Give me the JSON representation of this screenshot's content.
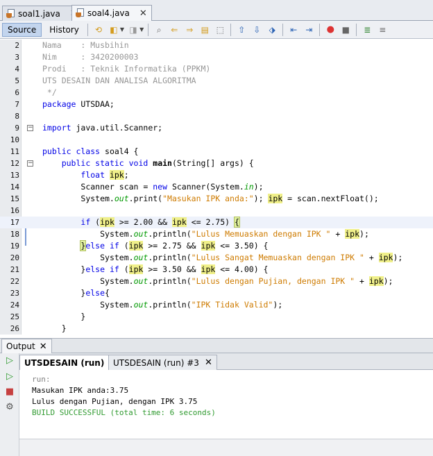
{
  "file_tabs": [
    {
      "label": "soal1.java",
      "active": false
    },
    {
      "label": "soal4.java",
      "active": true
    }
  ],
  "editor_toolbar": {
    "source_label": "Source",
    "history_label": "History"
  },
  "code_lines": [
    {
      "n": "2"
    },
    {
      "n": "3"
    },
    {
      "n": "4"
    },
    {
      "n": "5"
    },
    {
      "n": "6"
    },
    {
      "n": "7"
    },
    {
      "n": "8"
    },
    {
      "n": "9"
    },
    {
      "n": "10"
    },
    {
      "n": "11"
    },
    {
      "n": "12"
    },
    {
      "n": "13"
    },
    {
      "n": "14"
    },
    {
      "n": "15"
    },
    {
      "n": "16"
    },
    {
      "n": "17"
    },
    {
      "n": "18"
    },
    {
      "n": "19"
    },
    {
      "n": "20"
    },
    {
      "n": "21"
    },
    {
      "n": "22"
    },
    {
      "n": "23"
    },
    {
      "n": "24"
    },
    {
      "n": "25"
    },
    {
      "n": "26"
    }
  ],
  "code": {
    "l2a": "Nama    : Musbihin",
    "l3a": "Nim     : 3420200003",
    "l4a": "Prodi   : Teknik Informatika (PPKM)",
    "l5a": "UTS DESAIN DAN ANALISA ALGORITMA",
    "l6a": " */",
    "l7a": "package",
    "l7b": " UTSDAA;",
    "l9a": "import",
    "l9b": " java.util.Scanner;",
    "l11a": "public class",
    "l11b": " soal4 {",
    "l12a": "public static void",
    "l12b": "main",
    "l12c": "(String[] args) {",
    "l13a": "float",
    "l13b": "ipk",
    "l13c": ";",
    "l14a": "Scanner scan = ",
    "l14b": "new",
    "l14c": " Scanner(System.",
    "l14d": "in",
    "l14e": ");",
    "l15a": "System.",
    "l15b": "out",
    "l15c": ".print(",
    "l15d": "\"Masukan IPK anda:\"",
    "l15e": "); ",
    "l15f": "ipk",
    "l15g": " = scan.nextFloat();",
    "l17a": "if",
    "l17b": " (",
    "l17c": "ipk",
    "l17d": " >= 2.00 && ",
    "l17e": "ipk",
    "l17f": " <= 2.75) ",
    "l17g": "{",
    "l18a": "System.",
    "l18b": "out",
    "l18c": ".println(",
    "l18d": "\"Lulus Memuaskan dengan IPK \"",
    "l18e": " + ",
    "l18f": "ipk",
    "l18g": ");",
    "l19a": "}",
    "l19b": "else if",
    "l19c": " (",
    "l19d": "ipk",
    "l19e": " >= 2.75 && ",
    "l19f": "ipk",
    "l19g": " <= 3.50) {",
    "l20a": "System.",
    "l20b": "out",
    "l20c": ".println(",
    "l20d": "\"Lulus Sangat Memuaskan dengan IPK \"",
    "l20e": " + ",
    "l20f": "ipk",
    "l20g": ");",
    "l21a": "}",
    "l21b": "else if",
    "l21c": " (",
    "l21d": "ipk",
    "l21e": " >= 3.50 && ",
    "l21f": "ipk",
    "l21g": " <= 4.00) {",
    "l22a": "System.",
    "l22b": "out",
    "l22c": ".println(",
    "l22d": "\"Lulus dengan Pujian, dengan IPK \"",
    "l22e": " + ",
    "l22f": "ipk",
    "l22g": ");",
    "l23a": "}",
    "l23b": "else",
    "l23c": "{",
    "l24a": "System.",
    "l24b": "out",
    "l24c": ".println(",
    "l24d": "\"IPK Tidak Valid\"",
    "l24e": ");",
    "l25a": "}",
    "l26a": "}"
  },
  "output": {
    "window_label": "Output",
    "run_tabs": [
      {
        "label": "UTSDESAIN (run)",
        "selected": true
      },
      {
        "label": "UTSDESAIN (run) #3",
        "selected": false
      }
    ],
    "console": [
      "run:",
      "Masukan IPK anda:3.75",
      "Lulus dengan Pujian, dengan IPK 3.75",
      "BUILD SUCCESSFUL (total time: 6 seconds)"
    ]
  },
  "colors": {
    "keyword": "#0000e6",
    "string": "#ce7b00",
    "comment": "#969696",
    "field": "#009900",
    "highlight": "#f0f08a",
    "build_success": "#2f9a2f"
  }
}
